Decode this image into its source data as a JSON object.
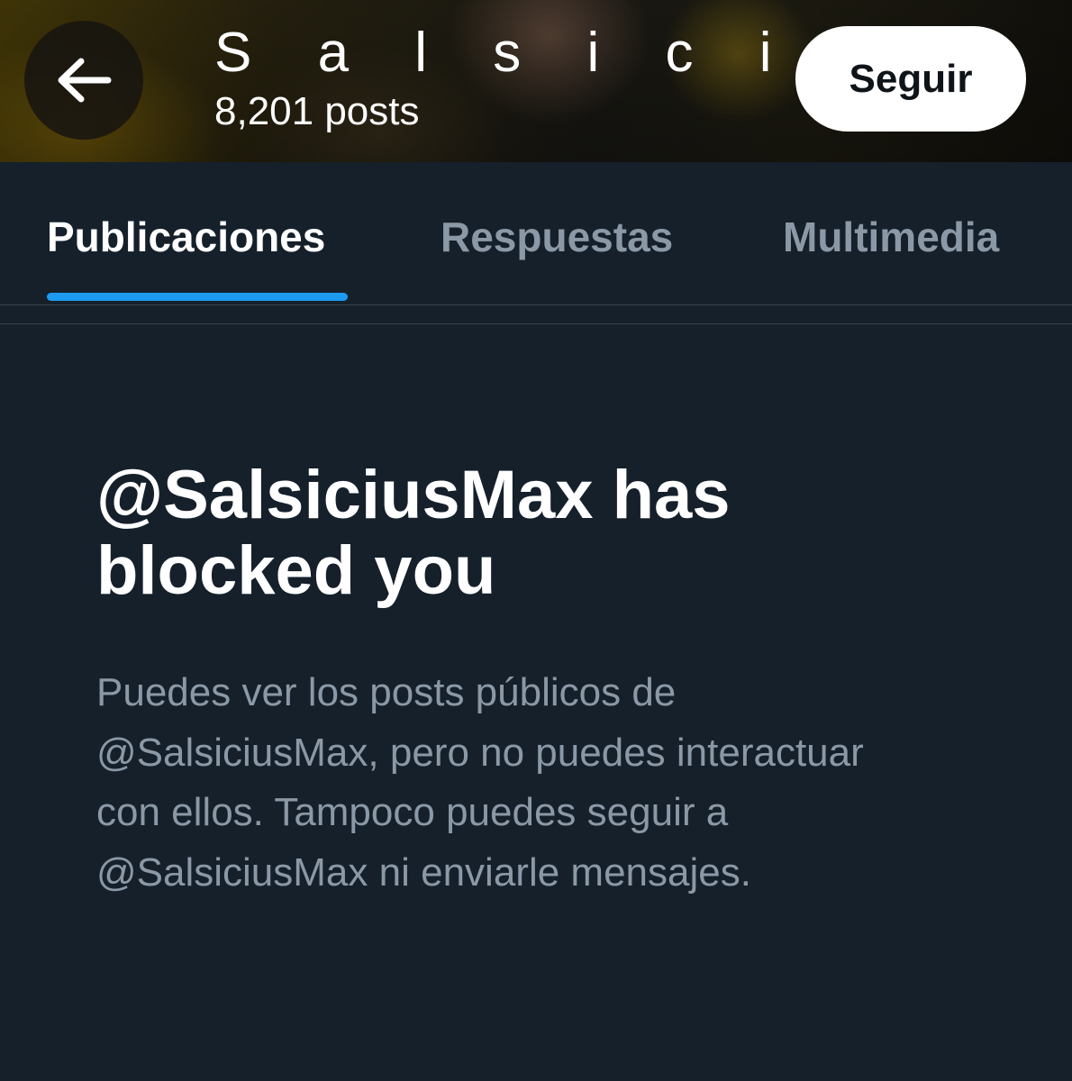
{
  "header": {
    "title": "S a l s i c i u…",
    "posts_count": "8,201 posts",
    "follow_label": "Seguir",
    "back_icon": "arrow-left-icon"
  },
  "tabs": [
    {
      "label": "Publicaciones",
      "active": true
    },
    {
      "label": "Respuestas",
      "active": false
    },
    {
      "label": "Multimedia",
      "active": false
    }
  ],
  "blocked": {
    "title": "@SalsiciusMax has blocked you",
    "description": "Puedes ver los posts públicos de @SalsiciusMax, pero no puedes interactuar con ellos. Tampoco puedes seguir a @SalsiciusMax ni enviarle mensajes."
  },
  "colors": {
    "background": "#15202b",
    "accent": "#1d9bf0",
    "secondary_text": "#8b98a5"
  }
}
